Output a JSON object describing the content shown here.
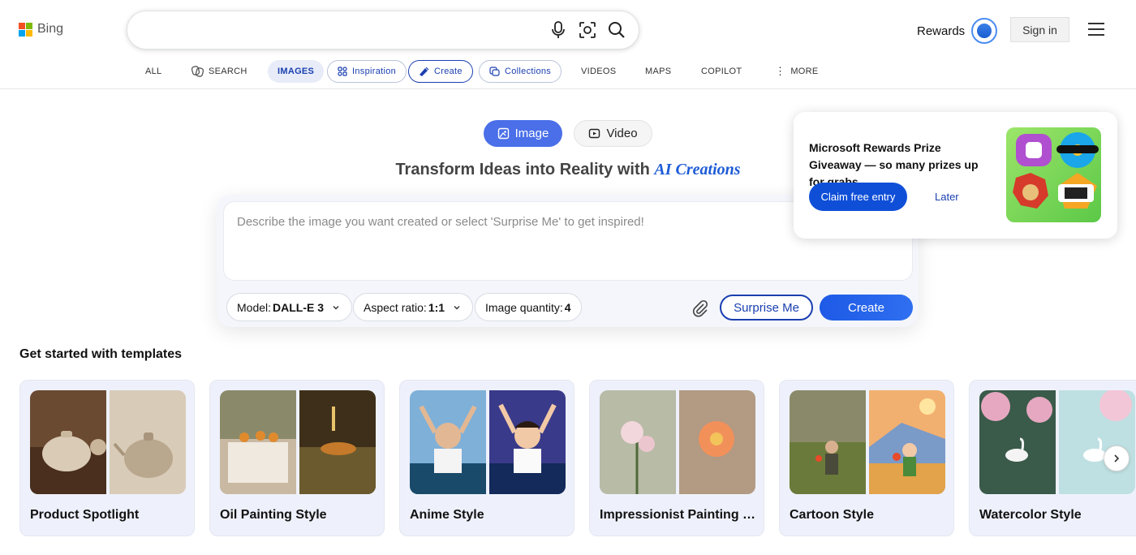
{
  "header": {
    "logo_text": "Bing",
    "search": {
      "value": "",
      "placeholder": ""
    },
    "rewards_label": "Rewards",
    "signin_label": "Sign in"
  },
  "nav": {
    "all": "ALL",
    "search": "SEARCH",
    "images": "IMAGES",
    "inspiration": "Inspiration",
    "create": "Create",
    "collections": "Collections",
    "videos": "VIDEOS",
    "maps": "MAPS",
    "copilot": "COPILOT",
    "more": "MORE",
    "active": "IMAGES"
  },
  "creator": {
    "toggle_image": "Image",
    "toggle_video": "Video",
    "toggle_selected": "Image",
    "headline_prefix": "Transform Ideas into Reality with",
    "headline_highlight": "AI Creations",
    "prompt_placeholder": "Describe the image you want created or select 'Surprise Me' to get inspired!",
    "model_label": "Model:",
    "model_value": "DALL-E 3",
    "aspect_label": "Aspect ratio:",
    "aspect_value": "1:1",
    "quantity_label": "Image quantity:",
    "quantity_value": "4",
    "surprise_label": "Surprise Me",
    "create_label": "Create"
  },
  "popup": {
    "title": "Microsoft Rewards Prize Giveaway — so many prizes up for grabs",
    "claim_label": "Claim free entry",
    "later_label": "Later"
  },
  "templates": {
    "heading": "Get started with templates",
    "items": [
      {
        "label": "Product Spotlight"
      },
      {
        "label": "Oil Painting Style"
      },
      {
        "label": "Anime Style"
      },
      {
        "label": "Impressionist Painting Style"
      },
      {
        "label": "Cartoon Style"
      },
      {
        "label": "Watercolor Style"
      }
    ]
  },
  "colors": {
    "accent": "#4a6fe8",
    "brand_blue": "#1a3fb0",
    "create_button": "#1e5ae6",
    "popup_claim": "#0f4fd8"
  },
  "icons": {
    "mic": "microphone-icon",
    "visual_search": "visual-search-icon",
    "search": "search-icon",
    "menu": "hamburger-menu-icon",
    "attach": "paperclip-icon",
    "next": "chevron-right-icon"
  }
}
